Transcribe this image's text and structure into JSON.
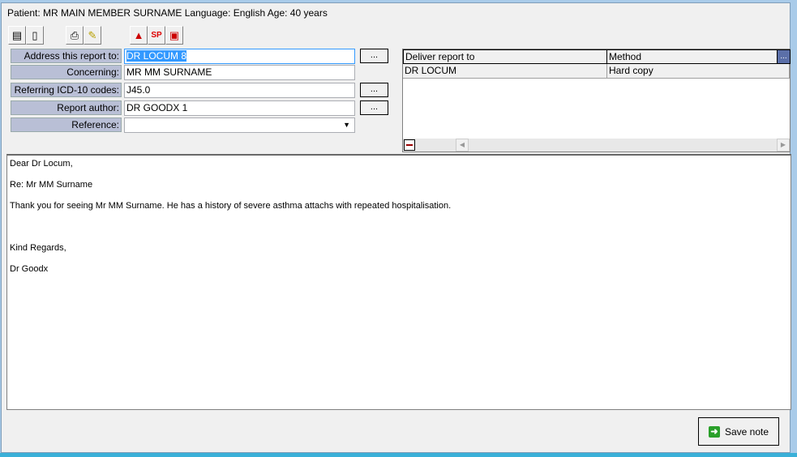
{
  "header": {
    "title": "Patient: MR MAIN MEMBER SURNAME  Language: English Age: 40 years"
  },
  "toolbar": [
    {
      "icon": "copy-pages-icon"
    },
    {
      "icon": "document-icon"
    },
    {
      "icon": "printer-icon"
    },
    {
      "icon": "notepad-edit-icon"
    },
    {
      "icon": "shapes-document-icon"
    },
    {
      "icon": "spell-check-icon"
    },
    {
      "icon": "clipboard-export-icon"
    }
  ],
  "form": {
    "address_label": "Address this report to:",
    "address_value": "DR LOCUM 8",
    "concerning_label": "Concerning:",
    "concerning_value": "MR MM SURNAME",
    "icd_label": "Referring ICD-10 codes:",
    "icd_value": "J45.0",
    "author_label": "Report author:",
    "author_value": "DR GOODX 1",
    "reference_label": "Reference:",
    "reference_value": "",
    "browse_label": "..."
  },
  "delivery": {
    "headers": [
      "Deliver report to",
      "Method"
    ],
    "rows": [
      [
        "DR LOCUM",
        "Hard copy"
      ]
    ],
    "more_label": "..."
  },
  "letter": [
    "Dear Dr Locum,",
    "Re:  Mr MM Surname",
    "Thank you for seeing Mr MM Surname.  He has a history of severe asthma attachs with repeated hospitalisation.",
    "",
    "Kind Regards,",
    "Dr Goodx"
  ],
  "footer": {
    "save_label": "Save note"
  }
}
